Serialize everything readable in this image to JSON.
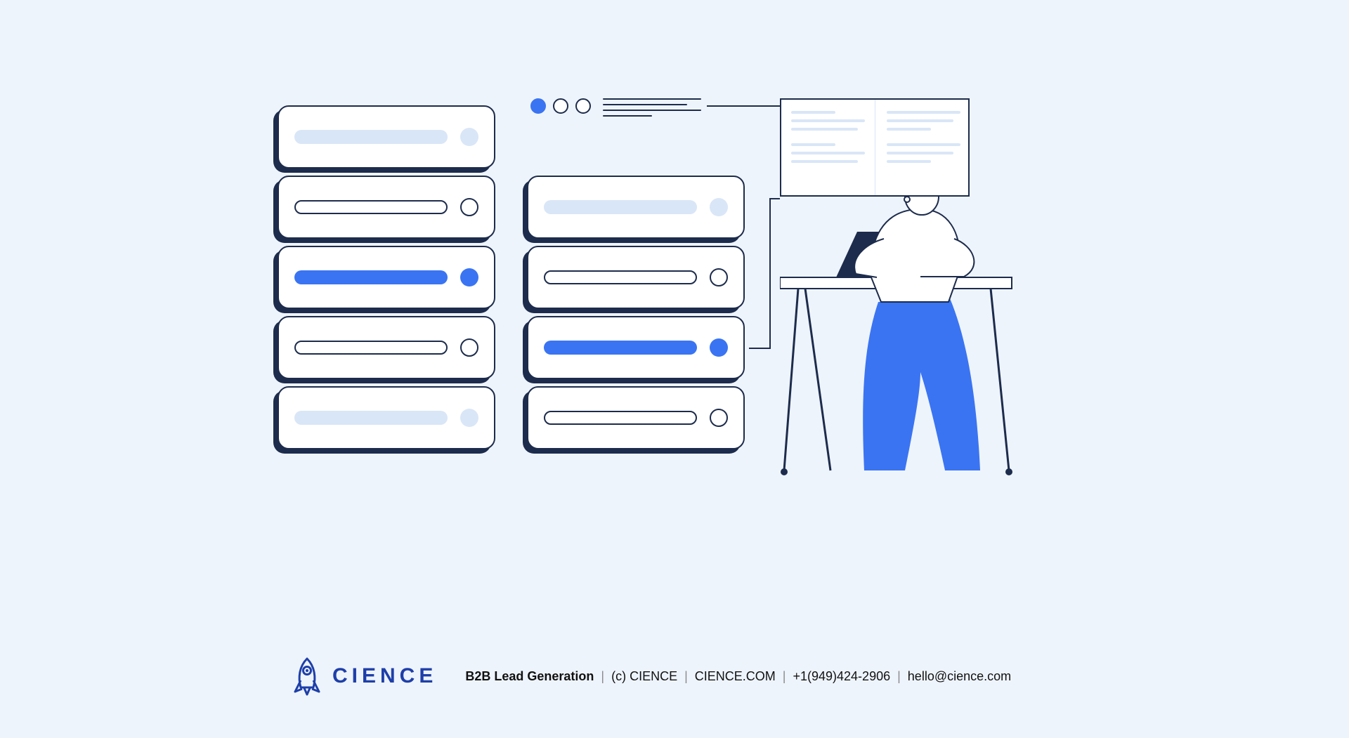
{
  "brand": {
    "name": "CIENCE"
  },
  "footer": {
    "tagline": "B2B Lead Generation",
    "copyright": "(c) CIENCE",
    "site": "CIENCE.COM",
    "phone": "+1(949)424-2906",
    "email": "hello@cience.com"
  },
  "illustration": {
    "columns": [
      {
        "id": "A",
        "slots": [
          {
            "variant": "muted"
          },
          {
            "variant": "outline"
          },
          {
            "variant": "active"
          },
          {
            "variant": "outline"
          },
          {
            "variant": "muted"
          }
        ]
      },
      {
        "id": "B",
        "slots": [
          {
            "variant": "muted"
          },
          {
            "variant": "outline"
          },
          {
            "variant": "active"
          },
          {
            "variant": "outline"
          }
        ]
      }
    ],
    "step_dots": {
      "total": 3,
      "filled_index": 0
    }
  },
  "colors": {
    "background": "#eef4fc",
    "ink": "#1d2c4c",
    "accent": "#3a74f2",
    "muted": "#d9e6f7",
    "brand": "#1e3fa9"
  }
}
